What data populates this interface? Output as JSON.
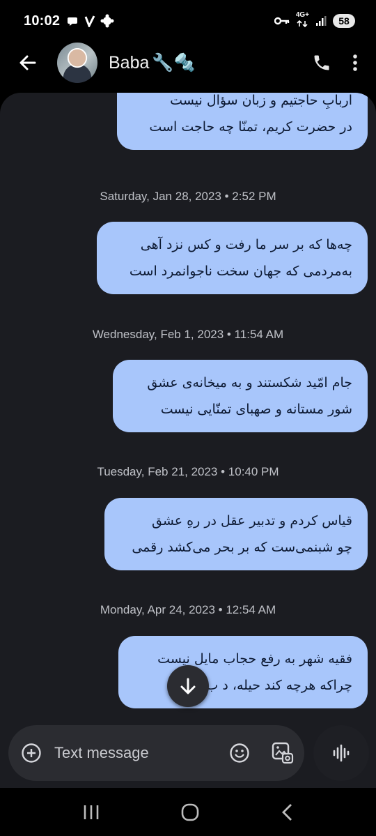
{
  "status_bar": {
    "time": "10:02",
    "network_label": "4G+",
    "battery": "58"
  },
  "header": {
    "contact_name": "Baba",
    "contact_emoji": "🔧🔩"
  },
  "messages": [
    {
      "lines": [
        "اربابِ حاجتیم و زبان سؤال نیست",
        "در حضرت کریم، تمنّا چه حاجت است"
      ]
    },
    {
      "date": "Saturday, Jan 28, 2023 • 2:52 PM",
      "lines": [
        "چه‌ها که بر سر ما رفت و کس نزد آهی",
        "به‌مردمی که جهان سخت ناجوانمرد است"
      ]
    },
    {
      "date": "Wednesday, Feb 1, 2023 • 11:54 AM",
      "lines": [
        "جام امّید شکستند و به میخانه‌ی عشق",
        "شور مستانه و صهبای تمنّایی نیست"
      ]
    },
    {
      "date": "Tuesday, Feb 21, 2023 • 10:40 PM",
      "lines": [
        "قیاس کردم و تدبیر عقل در رهِ عشق",
        "چو شبنمی‌ست که بر بحر می‌کشد رقمی"
      ]
    },
    {
      "date": "Monday, Apr 24, 2023 • 12:54 AM",
      "lines": [
        "فقیه شهر به رفع حجاب مایل نیست",
        "چراکه هرچه کند حیله، د    ب کند"
      ]
    }
  ],
  "compose": {
    "placeholder": "Text message"
  },
  "colors": {
    "bubble_bg": "#a8c6fb",
    "panel_bg": "#1b1c21",
    "compose_bg": "#2b2c31"
  }
}
